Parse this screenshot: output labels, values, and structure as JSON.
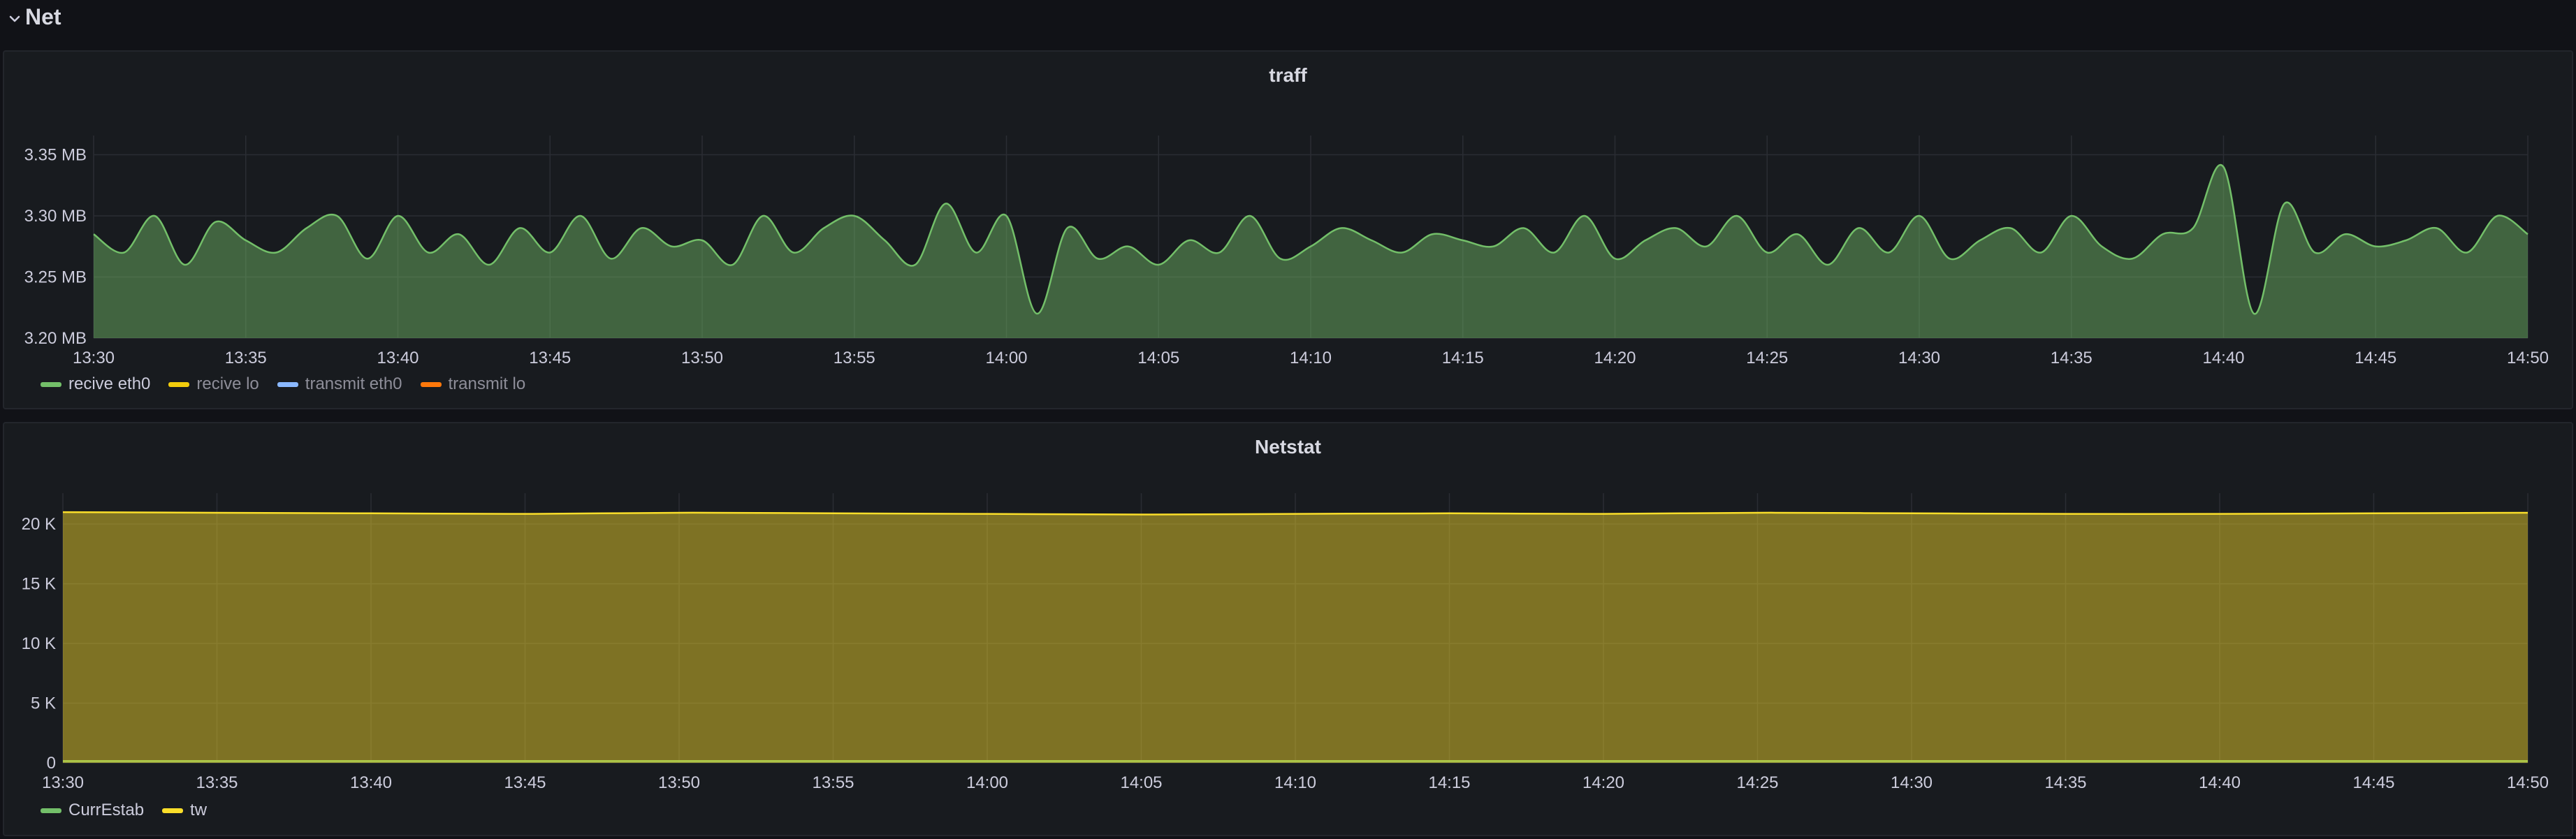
{
  "row": {
    "title": "Net",
    "icon": "chevron-down-icon"
  },
  "chart_data": [
    {
      "type": "area",
      "title": "traff",
      "x_ticks": [
        "13:30",
        "13:35",
        "13:40",
        "13:45",
        "13:50",
        "13:55",
        "14:00",
        "14:05",
        "14:10",
        "14:15",
        "14:20",
        "14:25",
        "14:30",
        "14:35",
        "14:40",
        "14:45",
        "14:50"
      ],
      "y_ticks": [
        "3.20 MB",
        "3.25 MB",
        "3.30 MB",
        "3.35 MB"
      ],
      "ylim": [
        3.2,
        3.36
      ],
      "unit": "MB",
      "xlim": [
        "13:30",
        "14:50"
      ],
      "grid": true,
      "legend_position": "bottom-left",
      "series": [
        {
          "name": "recive eth0",
          "color": "#73bf69",
          "visible": true,
          "x": [
            "13:30",
            "13:31",
            "13:32",
            "13:33",
            "13:34",
            "13:35",
            "13:36",
            "13:37",
            "13:38",
            "13:39",
            "13:40",
            "13:41",
            "13:42",
            "13:43",
            "13:44",
            "13:45",
            "13:46",
            "13:47",
            "13:48",
            "13:49",
            "13:50",
            "13:51",
            "13:52",
            "13:53",
            "13:54",
            "13:55",
            "13:56",
            "13:57",
            "13:58",
            "13:59",
            "14:00",
            "14:01",
            "14:02",
            "14:03",
            "14:04",
            "14:05",
            "14:06",
            "14:07",
            "14:08",
            "14:09",
            "14:10",
            "14:11",
            "14:12",
            "14:13",
            "14:14",
            "14:15",
            "14:16",
            "14:17",
            "14:18",
            "14:19",
            "14:20",
            "14:21",
            "14:22",
            "14:23",
            "14:24",
            "14:25",
            "14:26",
            "14:27",
            "14:28",
            "14:29",
            "14:30",
            "14:31",
            "14:32",
            "14:33",
            "14:34",
            "14:35",
            "14:36",
            "14:37",
            "14:38",
            "14:39",
            "14:40",
            "14:41",
            "14:42",
            "14:43",
            "14:44",
            "14:45",
            "14:46",
            "14:47",
            "14:48",
            "14:49",
            "14:50"
          ],
          "values": [
            3.285,
            3.27,
            3.3,
            3.26,
            3.295,
            3.28,
            3.27,
            3.29,
            3.3,
            3.265,
            3.3,
            3.27,
            3.285,
            3.26,
            3.29,
            3.27,
            3.3,
            3.265,
            3.29,
            3.275,
            3.28,
            3.26,
            3.3,
            3.27,
            3.29,
            3.3,
            3.28,
            3.26,
            3.31,
            3.27,
            3.3,
            3.22,
            3.29,
            3.265,
            3.275,
            3.26,
            3.28,
            3.27,
            3.3,
            3.265,
            3.275,
            3.29,
            3.28,
            3.27,
            3.285,
            3.28,
            3.275,
            3.29,
            3.27,
            3.3,
            3.265,
            3.28,
            3.29,
            3.275,
            3.3,
            3.27,
            3.285,
            3.26,
            3.29,
            3.27,
            3.3,
            3.265,
            3.28,
            3.29,
            3.27,
            3.3,
            3.275,
            3.265,
            3.285,
            3.29,
            3.34,
            3.22,
            3.31,
            3.27,
            3.285,
            3.275,
            3.28,
            3.29,
            3.27,
            3.3,
            3.285
          ],
          "data_note": ""
        },
        {
          "name": "recive lo",
          "color": "#f2cc0c",
          "visible": false
        },
        {
          "name": "transmit eth0",
          "color": "#8ab8ff",
          "visible": false
        },
        {
          "name": "transmit lo",
          "color": "#ff780a",
          "visible": false
        }
      ]
    },
    {
      "type": "area",
      "title": "Netstat",
      "x_ticks": [
        "13:30",
        "13:35",
        "13:40",
        "13:45",
        "13:50",
        "13:55",
        "14:00",
        "14:05",
        "14:10",
        "14:15",
        "14:20",
        "14:25",
        "14:30",
        "14:35",
        "14:40",
        "14:45",
        "14:50"
      ],
      "y_ticks": [
        "0",
        "5 K",
        "10 K",
        "15 K",
        "20 K"
      ],
      "ylim": [
        0,
        22000
      ],
      "xlim": [
        "13:30",
        "14:50"
      ],
      "grid": true,
      "legend_position": "bottom-left",
      "series": [
        {
          "name": "CurrEstab",
          "color": "#73bf69",
          "visible": true,
          "x": [
            "13:30",
            "13:40",
            "13:50",
            "14:00",
            "14:10",
            "14:20",
            "14:30",
            "14:40",
            "14:50"
          ],
          "values": [
            150,
            150,
            150,
            150,
            150,
            150,
            150,
            150,
            150
          ]
        },
        {
          "name": "tw",
          "color": "#fade2a",
          "visible": true,
          "x": [
            "13:30",
            "13:35",
            "13:40",
            "13:45",
            "13:50",
            "13:55",
            "14:00",
            "14:05",
            "14:10",
            "14:15",
            "14:20",
            "14:25",
            "14:30",
            "14:35",
            "14:40",
            "14:45",
            "14:50"
          ],
          "values": [
            21000,
            20950,
            20900,
            20850,
            20950,
            20900,
            20850,
            20800,
            20850,
            20900,
            20850,
            20950,
            20900,
            20850,
            20850,
            20900,
            20950
          ]
        }
      ]
    }
  ]
}
